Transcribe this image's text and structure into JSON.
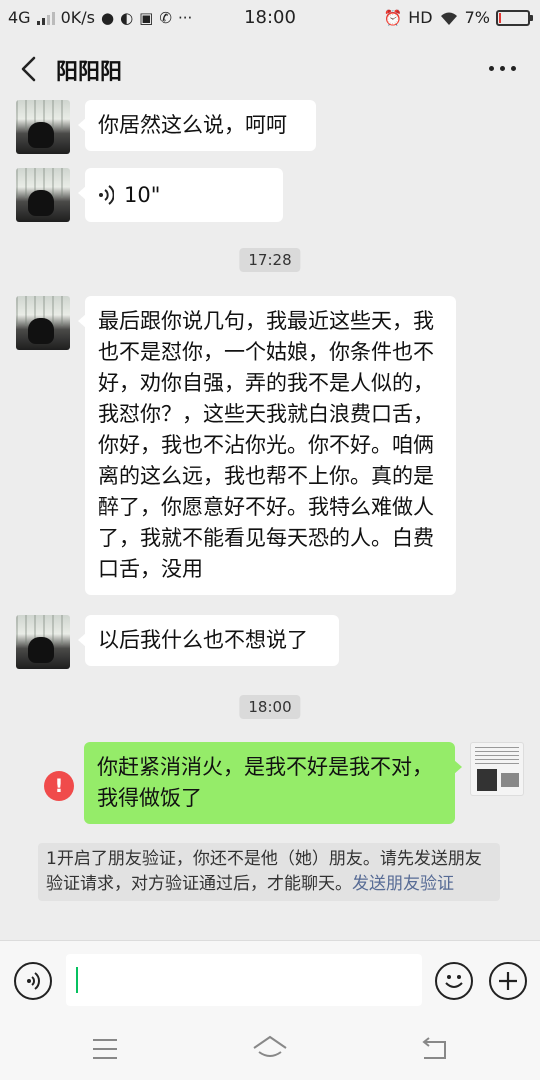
{
  "status_bar": {
    "network": "4G",
    "speed": "0K/s",
    "time": "18:00",
    "hd": "HD",
    "battery_percent": "7%",
    "battery_level": 0.07,
    "battery_color": "#e53935"
  },
  "header": {
    "back_icon": "chevron-left-icon",
    "title": "阳阳阳",
    "more_icon": "more-dots-icon"
  },
  "messages": [
    {
      "side": "left",
      "type": "text",
      "text": "你居然这么说，呵呵"
    },
    {
      "side": "left",
      "type": "voice",
      "duration": "10\""
    },
    {
      "type": "time",
      "text": "17:28"
    },
    {
      "side": "left",
      "type": "text",
      "text": "最后跟你说几句，我最近这些天，我也不是怼你，一个姑娘，你条件也不好，劝你自强，弄的我不是人似的，我怼你？，这些天我就白浪费口舌，你好，我也不沾你光。你不好。咱俩离的这么远，我也帮不上你。真的是醉了，你愿意好不好。我特么难做人了，我就不能看见每天恐的人。白费口舌，没用"
    },
    {
      "side": "left",
      "type": "text",
      "text": "以后我什么也不想说了"
    },
    {
      "type": "time",
      "text": "18:00"
    },
    {
      "side": "right",
      "type": "text",
      "status": "failed",
      "text": "你赶紧消消火，是我不好是我不对，我得做饭了"
    }
  ],
  "system_notice": {
    "text": "1开启了朋友验证，你还不是他（她）朋友。请先发送朋友验证请求，对方验证通过后，才能聊天。",
    "link": "发送朋友验证"
  },
  "input_bar": {
    "voice_icon": "voice-input-icon",
    "emoji_icon": "emoji-icon",
    "plus_icon": "plus-icon"
  },
  "colors": {
    "my_bubble": "#95ec69",
    "their_bubble": "#ffffff",
    "background": "#ededed",
    "error": "#f04b4b",
    "link": "#576b95"
  }
}
